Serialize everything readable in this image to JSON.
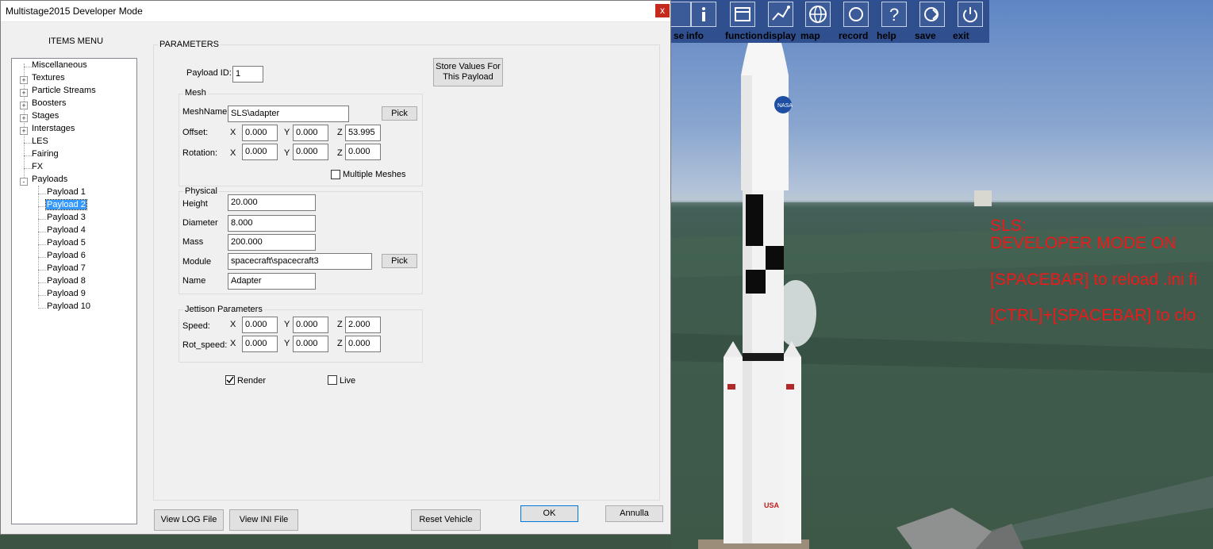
{
  "window": {
    "title": "Multistage2015 Developer Mode",
    "close_glyph": "x"
  },
  "items_menu": {
    "label": "ITEMS MENU",
    "tree": [
      {
        "label": "Miscellaneous",
        "expander": ""
      },
      {
        "label": "Textures",
        "expander": "+"
      },
      {
        "label": "Particle Streams",
        "expander": "+"
      },
      {
        "label": "Boosters",
        "expander": "+"
      },
      {
        "label": "Stages",
        "expander": "+"
      },
      {
        "label": "Interstages",
        "expander": "+"
      },
      {
        "label": "LES",
        "expander": ""
      },
      {
        "label": "Fairing",
        "expander": ""
      },
      {
        "label": "FX",
        "expander": ""
      },
      {
        "label": "Payloads",
        "expander": "-"
      }
    ],
    "payloads": [
      "Payload 1",
      "Payload 2",
      "Payload 3",
      "Payload 4",
      "Payload 5",
      "Payload 6",
      "Payload 7",
      "Payload 8",
      "Payload 9",
      "Payload 10"
    ],
    "selected": "Payload 2"
  },
  "parameters": {
    "title": "PARAMETERS",
    "payload_id_label": "Payload ID:",
    "payload_id": "1",
    "store_button": "Store Values For This Payload",
    "mesh": {
      "title": "Mesh",
      "meshname_label": "MeshName",
      "meshname": "SLS\\adapter",
      "pick_label": "Pick",
      "offset_label": "Offset:",
      "offset": {
        "x": "0.000",
        "y": "0.000",
        "z": "53.995"
      },
      "rotation_label": "Rotation:",
      "rotation": {
        "x": "0.000",
        "y": "0.000",
        "z": "0.000"
      },
      "x_label": "X",
      "y_label": "Y",
      "z_label": "Z",
      "multiple_meshes_label": "Multiple Meshes",
      "multiple_meshes_checked": false
    },
    "physical": {
      "title": "Physical",
      "height_label": "Height",
      "height": "20.000",
      "diameter_label": "Diameter",
      "diameter": "8.000",
      "mass_label": "Mass",
      "mass": "200.000",
      "module_label": "Module",
      "module": "spacecraft\\spacecraft3",
      "pick_label": "Pick",
      "name_label": "Name",
      "name": "Adapter"
    },
    "jettison": {
      "title": "Jettison Parameters",
      "speed_label": "Speed:",
      "speed": {
        "x": "0.000",
        "y": "0.000",
        "z": "2.000"
      },
      "rot_speed_label": "Rot_speed:",
      "rot_speed": {
        "x": "0.000",
        "y": "0.000",
        "z": "0.000"
      }
    },
    "render_label": "Render",
    "render_checked": true,
    "live_label": "Live",
    "live_checked": false
  },
  "footer": {
    "view_log": "View LOG File",
    "view_ini": "View INI File",
    "reset_vehicle": "Reset Vehicle",
    "ok": "OK",
    "cancel": "Annulla"
  },
  "toolbar": {
    "items": [
      {
        "label": "se",
        "icon": "pause-icon"
      },
      {
        "label": "info",
        "icon": "info-icon"
      },
      {
        "label": "function",
        "icon": "function-icon"
      },
      {
        "label": "display",
        "icon": "display-icon"
      },
      {
        "label": "map",
        "icon": "globe-icon"
      },
      {
        "label": "record",
        "icon": "record-icon"
      },
      {
        "label": "help",
        "icon": "help-icon"
      },
      {
        "label": "save",
        "icon": "save-icon"
      },
      {
        "label": "exit",
        "icon": "power-icon"
      }
    ]
  },
  "overlay": {
    "line1": "SLS:",
    "line2": "DEVELOPER MODE ON",
    "line3": "[SPACEBAR] to reload .ini fi",
    "line4": "[CTRL]+[SPACEBAR] to clo",
    "color": "#ee1a1a",
    "rocket_markings": [
      "NASA",
      "USA"
    ]
  }
}
